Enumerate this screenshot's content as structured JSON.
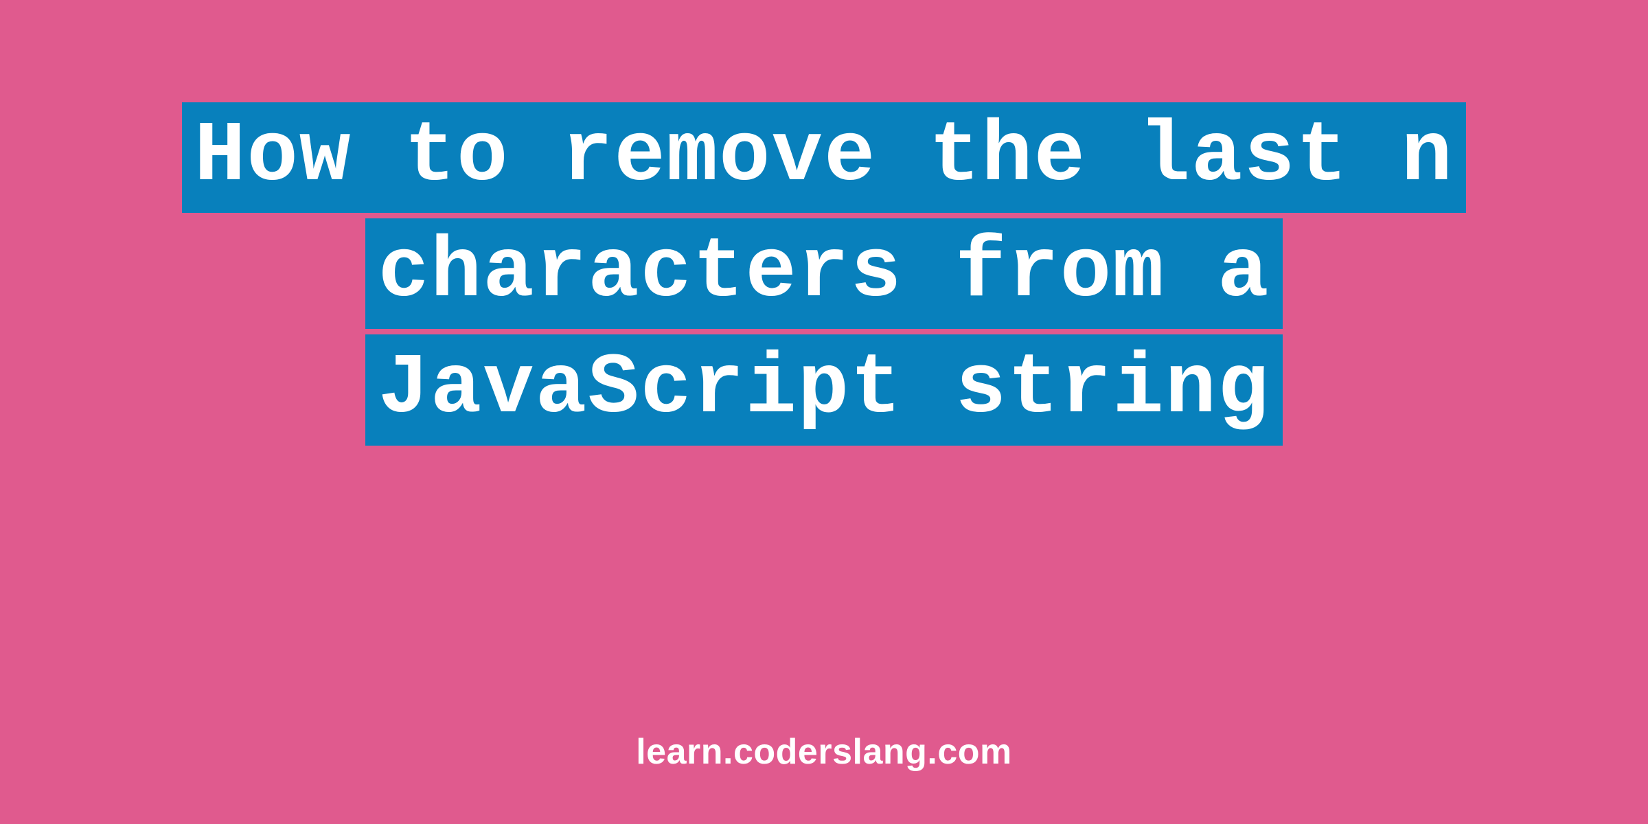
{
  "title": {
    "line1": "How to remove the last n",
    "line2": "characters from a",
    "line3": "JavaScript string"
  },
  "footer": "learn.coderslang.com",
  "colors": {
    "background": "#e05a8e",
    "highlight": "#0880bc",
    "text": "#ffffff"
  }
}
